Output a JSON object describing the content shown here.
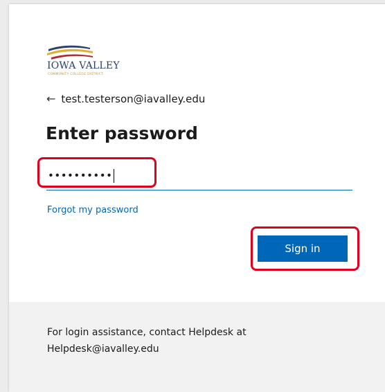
{
  "logo": {
    "name": "IOWA VALLEY",
    "subtitle": "COMMUNITY COLLEGE DISTRICT",
    "colors": {
      "navy": "#2c3f6e",
      "gold": "#e0b12e",
      "red": "#b8292f"
    }
  },
  "identity": {
    "back_icon": "back-arrow-icon",
    "email": "test.testerson@iavalley.edu"
  },
  "title": "Enter password",
  "password": {
    "masked_value": "••••••••••"
  },
  "links": {
    "forgot": "Forgot my password"
  },
  "buttons": {
    "sign_in": "Sign in"
  },
  "footer": {
    "text": "For login assistance, contact Helpdesk at Helpdesk@iavalley.edu"
  },
  "colors": {
    "accent": "#0067b8",
    "highlight": "#e0001b",
    "footer_bg": "#f2f2f2"
  }
}
